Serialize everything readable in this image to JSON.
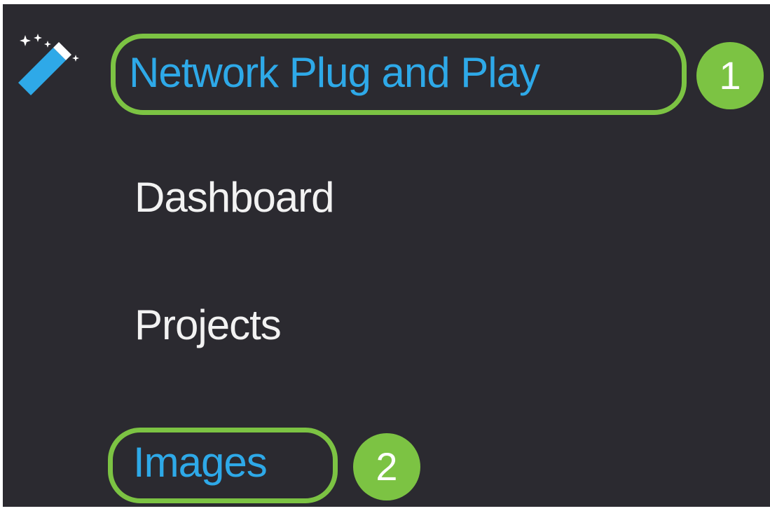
{
  "nav": {
    "section_icon": "magic-wand-icon",
    "section_title": "Network Plug and Play",
    "items": [
      {
        "label": "Dashboard"
      },
      {
        "label": "Projects"
      },
      {
        "label": "Images"
      }
    ]
  },
  "annotations": {
    "step_1": "1",
    "step_2": "2"
  },
  "colors": {
    "background": "#2b2a30",
    "link_blue": "#2ea9e8",
    "item_text": "#f2f2f2",
    "highlight_green": "#7cc343"
  }
}
